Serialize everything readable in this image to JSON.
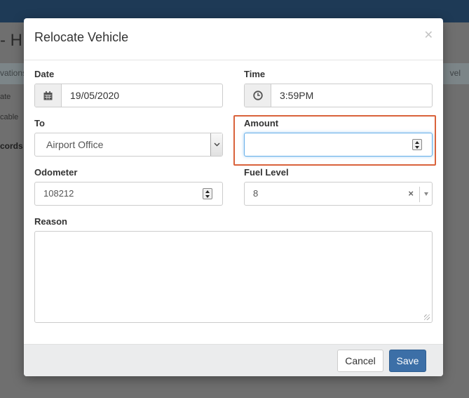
{
  "background": {
    "title": "- H",
    "tab_fragment": "vations",
    "right_tab_fragment": "vel",
    "column_fragment": "ate",
    "cell_fragment": "cable",
    "records_fragment": "cords"
  },
  "modal": {
    "title": "Relocate Vehicle",
    "close_icon": "close-icon"
  },
  "form": {
    "date": {
      "label": "Date",
      "value": "19/05/2020",
      "icon": "calendar-icon"
    },
    "time": {
      "label": "Time",
      "value": "3:59PM",
      "icon": "clock-icon"
    },
    "to": {
      "label": "To",
      "value": "Airport Office"
    },
    "amount": {
      "label": "Amount",
      "value": ""
    },
    "odometer": {
      "label": "Odometer",
      "value": "108212"
    },
    "fuel_level": {
      "label": "Fuel Level",
      "value": "8",
      "clear": "×"
    },
    "reason": {
      "label": "Reason",
      "value": ""
    }
  },
  "footer": {
    "cancel_label": "Cancel",
    "save_label": "Save"
  },
  "colors": {
    "highlight": "#d9623b",
    "primary": "#3c6fa7",
    "topbar": "#1e3a56"
  }
}
